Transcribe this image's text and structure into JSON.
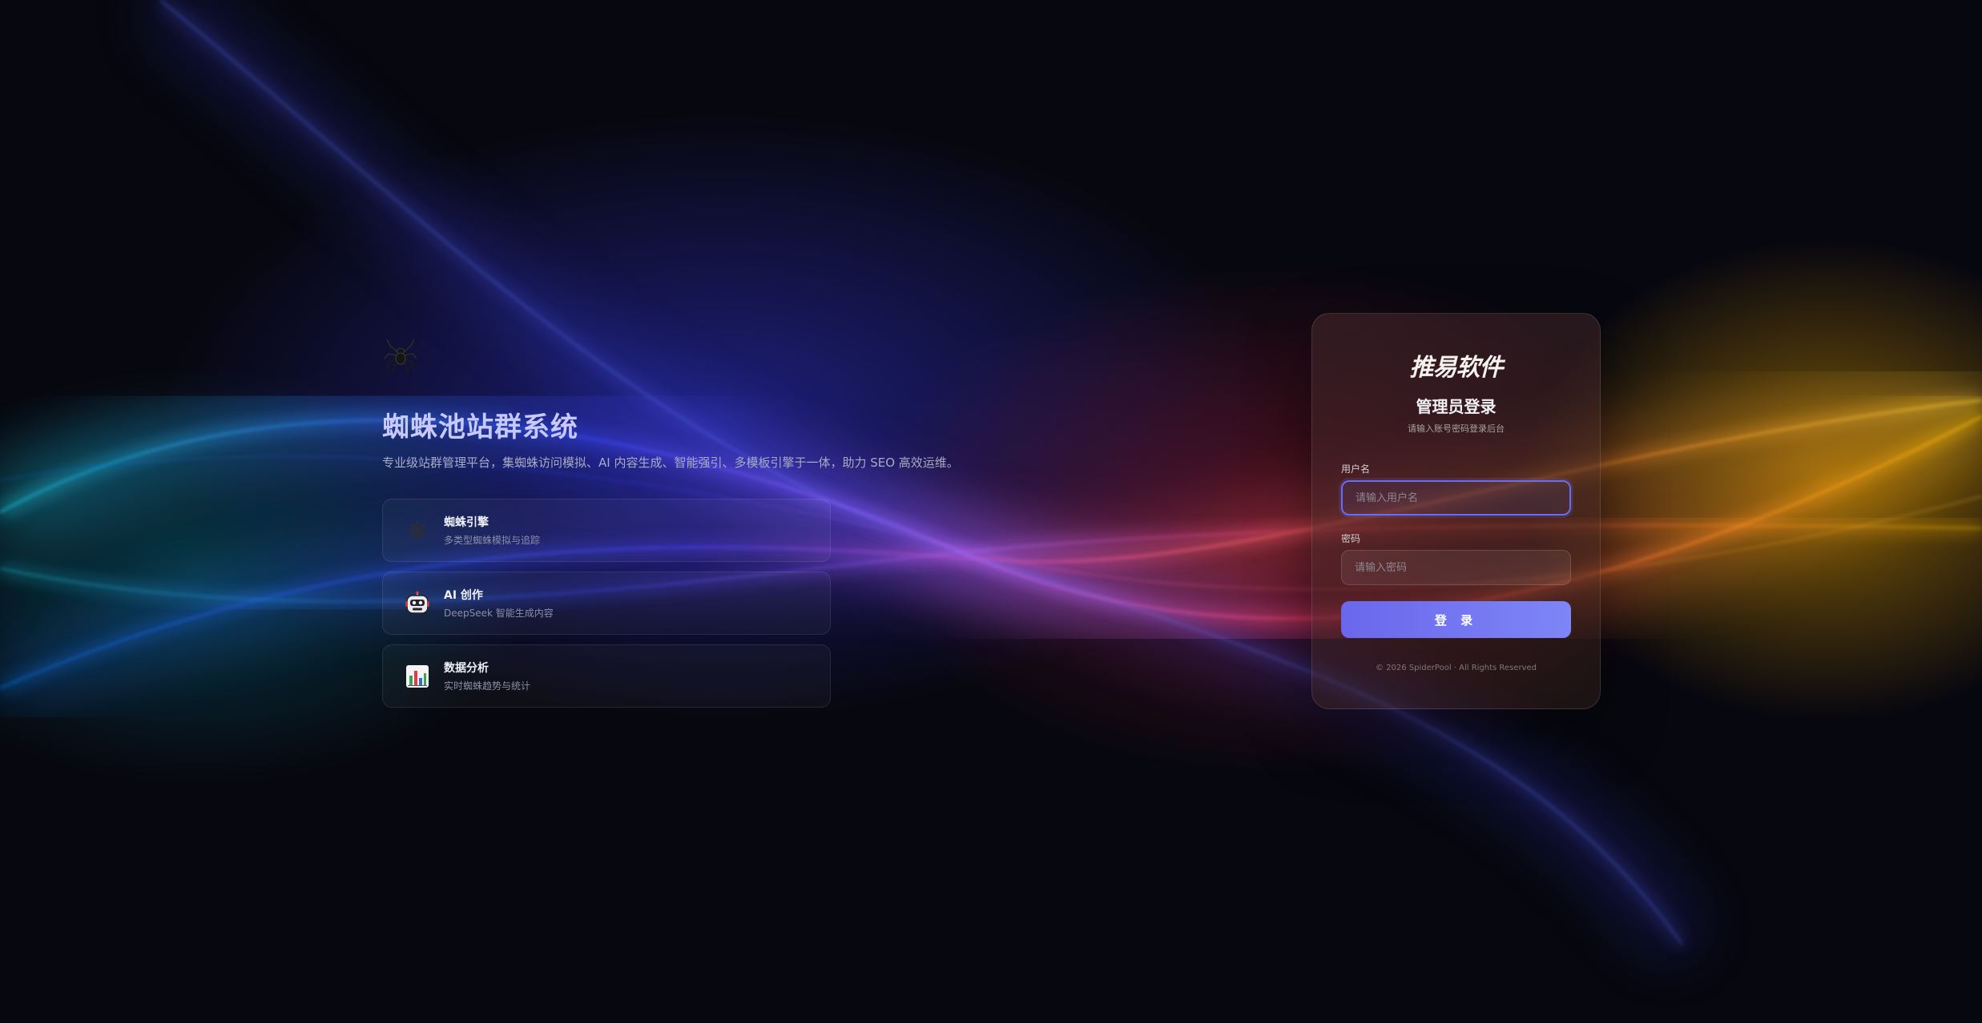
{
  "hero": {
    "logo_icon": "spider-icon",
    "title": "蜘蛛池站群系统",
    "description": "专业级站群管理平台，集蜘蛛访问模拟、AI 内容生成、智能强引、多模板引擎于一体，助力 SEO 高效运维。"
  },
  "features": [
    {
      "icon": "spider-web-icon",
      "title": "蜘蛛引擎",
      "subtitle": "多类型蜘蛛模拟与追踪"
    },
    {
      "icon": "robot-icon",
      "title": "AI 创作",
      "subtitle": "DeepSeek 智能生成内容"
    },
    {
      "icon": "bar-chart-icon",
      "title": "数据分析",
      "subtitle": "实时蜘蛛趋势与统计"
    }
  ],
  "login": {
    "brand": "推易软件",
    "title": "管理员登录",
    "subtitle": "请输入账号密码登录后台",
    "username_label": "用户名",
    "username_placeholder": "请输入用户名",
    "username_value": "",
    "password_label": "密码",
    "password_placeholder": "请输入密码",
    "password_value": "",
    "submit_label": "登 录",
    "copyright": "© 2026 SpiderPool · All Rights Reserved"
  },
  "colors": {
    "accent": "#6b6cf0",
    "background": "#07070f",
    "title": "#c7c9ff"
  }
}
